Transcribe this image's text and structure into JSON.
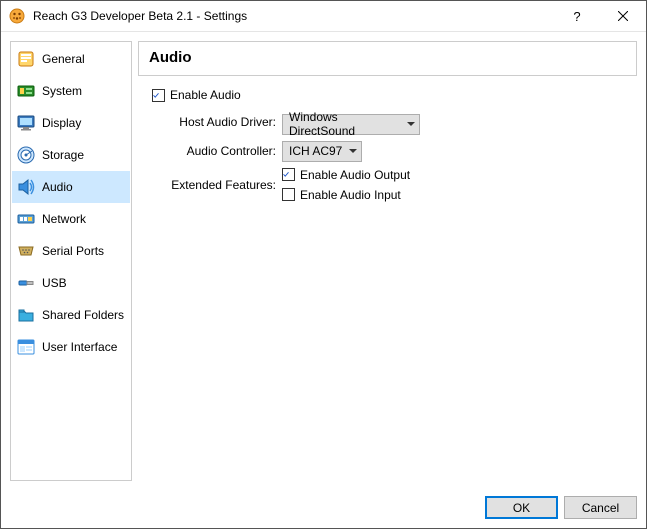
{
  "window": {
    "title": "Reach G3 Developer Beta 2.1 - Settings"
  },
  "sidebar": {
    "items": [
      {
        "label": "General"
      },
      {
        "label": "System"
      },
      {
        "label": "Display"
      },
      {
        "label": "Storage"
      },
      {
        "label": "Audio"
      },
      {
        "label": "Network"
      },
      {
        "label": "Serial Ports"
      },
      {
        "label": "USB"
      },
      {
        "label": "Shared Folders"
      },
      {
        "label": "User Interface"
      }
    ],
    "selected_index": 4
  },
  "panel": {
    "title": "Audio",
    "enable_audio_label": "Enable Audio",
    "enable_audio_checked": true,
    "host_driver_label": "Host Audio Driver:",
    "host_driver_value": "Windows DirectSound",
    "controller_label": "Audio Controller:",
    "controller_value": "ICH AC97",
    "extended_label": "Extended Features:",
    "enable_output_label": "Enable Audio Output",
    "enable_output_checked": true,
    "enable_input_label": "Enable Audio Input",
    "enable_input_checked": false
  },
  "buttons": {
    "ok": "OK",
    "cancel": "Cancel"
  }
}
